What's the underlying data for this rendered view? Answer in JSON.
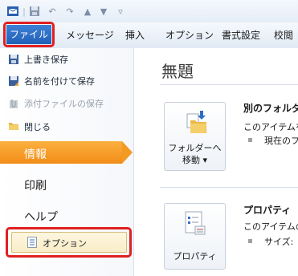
{
  "ribbon": {
    "file_tab": "ファイル",
    "tabs": [
      "メッセージ",
      "挿入",
      "オプション",
      "書式設定",
      "校閲"
    ]
  },
  "backstage": {
    "commands": [
      "上書き保存",
      "名前を付けて保存",
      "添付ファイルの保存",
      "閉じる"
    ],
    "nav": {
      "info": "情報",
      "print": "印刷",
      "help": "ヘルプ"
    },
    "options": "オプション"
  },
  "info": {
    "title": "無題",
    "move_button": {
      "line1": "フォルダーへ",
      "line2": "移動 ▾"
    },
    "move_section": {
      "title": "別のフォルダ",
      "text": "このアイテムを",
      "bullet": "現在のフ"
    },
    "properties_button": "プロパティ",
    "properties_section": {
      "title": "プロパティ",
      "text": "このアイテムの",
      "bullet": "サイズ:"
    }
  },
  "colors": {
    "file_tab": "#2a68be",
    "selected": "#f59a1f",
    "highlight": "#e02020"
  }
}
